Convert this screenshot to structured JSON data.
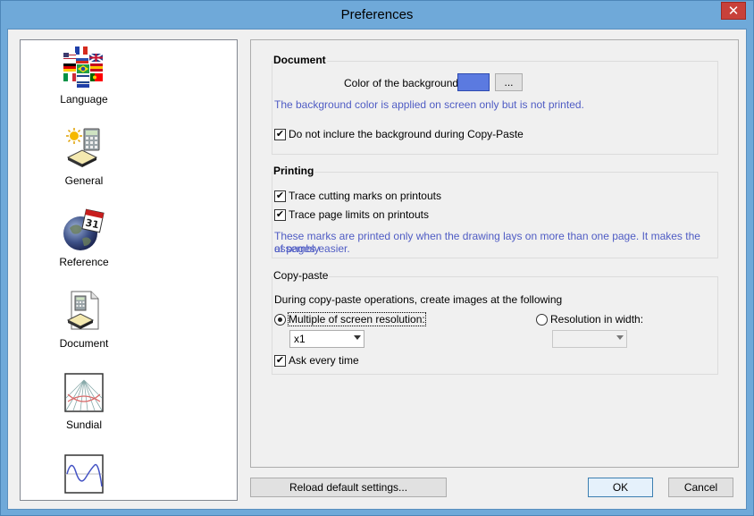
{
  "window": {
    "title": "Preferences",
    "close_glyph": "✕"
  },
  "sidebar": {
    "items": [
      {
        "label": "Language",
        "icon": "flags-icon"
      },
      {
        "label": "General",
        "icon": "calculator-sun-icon"
      },
      {
        "label": "Reference",
        "icon": "globe-calendar-icon"
      },
      {
        "label": "Document",
        "icon": "document-calculator-icon"
      },
      {
        "label": "Sundial",
        "icon": "sundial-icon"
      },
      {
        "label": "",
        "icon": "wave-icon"
      }
    ]
  },
  "document": {
    "title": "Document",
    "bg_color_label": "Color of the background:",
    "bg_color_value": "#5b7ae0",
    "browse_label": "...",
    "bg_note": "The background color is applied on screen only but is not printed.",
    "exclude_bg_label": "Do not inclure the background during Copy-Paste",
    "exclude_bg_checked": true
  },
  "printing": {
    "title": "Printing",
    "cut_marks_label": "Trace cutting marks on printouts",
    "page_limits_label": "Trace page limits on printouts",
    "note_line1": "These marks are printed only when the drawing lays on more than one page. It makes the assembly",
    "note_line2": "of pages easier."
  },
  "copypaste": {
    "title": "Copy-paste",
    "intro": "During copy-paste operations, create images at the following",
    "multiple_label": "Multiple of screen resolution:",
    "multiple_value": "x1",
    "resolution_label": "Resolution in width:",
    "resolution_value": "",
    "ask_label": "Ask every time"
  },
  "footer": {
    "reload_label": "Reload default settings...",
    "ok_label": "OK",
    "cancel_label": "Cancel"
  },
  "glyphs": {
    "check": "✔"
  },
  "colors": {
    "note": "#4f5cc4",
    "titlebar": "#6fa9d9",
    "close": "#c8413a"
  }
}
